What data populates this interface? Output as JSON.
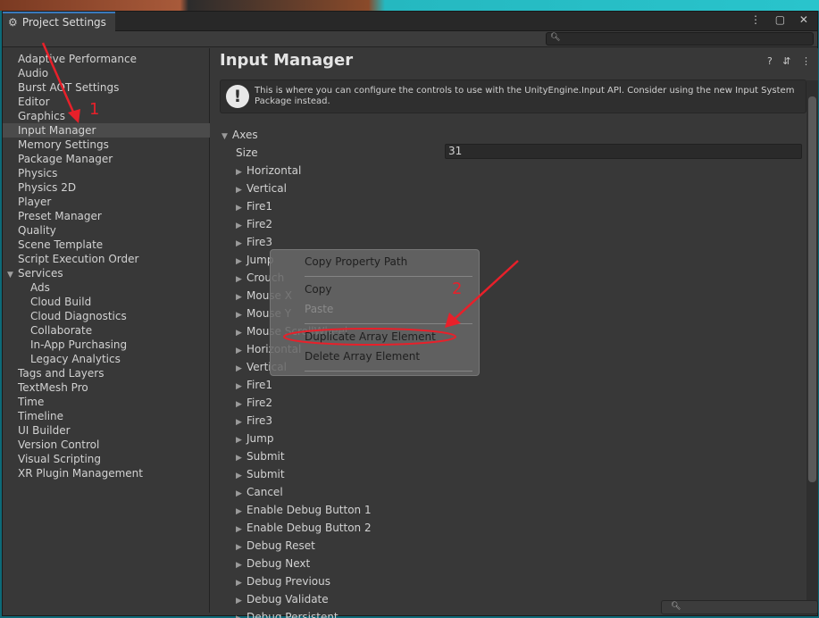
{
  "window": {
    "tab_title": "Project Settings",
    "tab_icon": "gear-icon",
    "controls": "⋮ ▢ ✕"
  },
  "toolbar": {
    "search_placeholder": ""
  },
  "sidebar": {
    "items": [
      {
        "label": "Adaptive Performance",
        "indent": 0
      },
      {
        "label": "Audio",
        "indent": 0
      },
      {
        "label": "Burst AOT Settings",
        "indent": 0
      },
      {
        "label": "Editor",
        "indent": 0
      },
      {
        "label": "Graphics",
        "indent": 0
      },
      {
        "label": "Input Manager",
        "indent": 0,
        "selected": true
      },
      {
        "label": "Memory Settings",
        "indent": 0
      },
      {
        "label": "Package Manager",
        "indent": 0
      },
      {
        "label": "Physics",
        "indent": 0
      },
      {
        "label": "Physics 2D",
        "indent": 0
      },
      {
        "label": "Player",
        "indent": 0
      },
      {
        "label": "Preset Manager",
        "indent": 0
      },
      {
        "label": "Quality",
        "indent": 0
      },
      {
        "label": "Scene Template",
        "indent": 0
      },
      {
        "label": "Script Execution Order",
        "indent": 0
      },
      {
        "label": "Services",
        "indent": 0,
        "expanded": true
      },
      {
        "label": "Ads",
        "indent": 1
      },
      {
        "label": "Cloud Build",
        "indent": 1
      },
      {
        "label": "Cloud Diagnostics",
        "indent": 1
      },
      {
        "label": "Collaborate",
        "indent": 1
      },
      {
        "label": "In-App Purchasing",
        "indent": 1
      },
      {
        "label": "Legacy Analytics",
        "indent": 1
      },
      {
        "label": "Tags and Layers",
        "indent": 0
      },
      {
        "label": "TextMesh Pro",
        "indent": 0
      },
      {
        "label": "Time",
        "indent": 0
      },
      {
        "label": "Timeline",
        "indent": 0
      },
      {
        "label": "UI Builder",
        "indent": 0
      },
      {
        "label": "Version Control",
        "indent": 0
      },
      {
        "label": "Visual Scripting",
        "indent": 0
      },
      {
        "label": "XR Plugin Management",
        "indent": 0
      }
    ]
  },
  "main": {
    "title": "Input Manager",
    "header_icons": [
      "help-icon",
      "presets-icon",
      "more-icon"
    ],
    "help_text": "This is where you can configure the controls to use with the UnityEngine.Input API. Consider using the new Input System Package instead.",
    "axes_label": "Axes",
    "size_label": "Size",
    "size_value": "31",
    "axes": [
      "Horizontal",
      "Vertical",
      "Fire1",
      "Fire2",
      "Fire3",
      "Jump",
      "Crouch",
      "Mouse X",
      "Mouse Y",
      "Mouse ScrollWheel",
      "Horizontal",
      "Vertical",
      "Fire1",
      "Fire2",
      "Fire3",
      "Jump",
      "Submit",
      "Submit",
      "Cancel",
      "Enable Debug Button 1",
      "Enable Debug Button 2",
      "Debug Reset",
      "Debug Next",
      "Debug Previous",
      "Debug Validate",
      "Debug Persistent"
    ]
  },
  "context_menu": {
    "items": [
      {
        "label": "Copy Property Path",
        "enabled": true
      },
      {
        "label": "Copy",
        "enabled": true
      },
      {
        "label": "Paste",
        "enabled": false
      },
      {
        "label": "Duplicate Array Element",
        "enabled": true
      },
      {
        "label": "Delete Array Element",
        "enabled": true
      }
    ]
  },
  "annotations": {
    "marker_1": "1",
    "marker_2": "2",
    "color": "#e8202a"
  },
  "colors": {
    "accent": "#3a79bb",
    "panel": "#383838"
  }
}
